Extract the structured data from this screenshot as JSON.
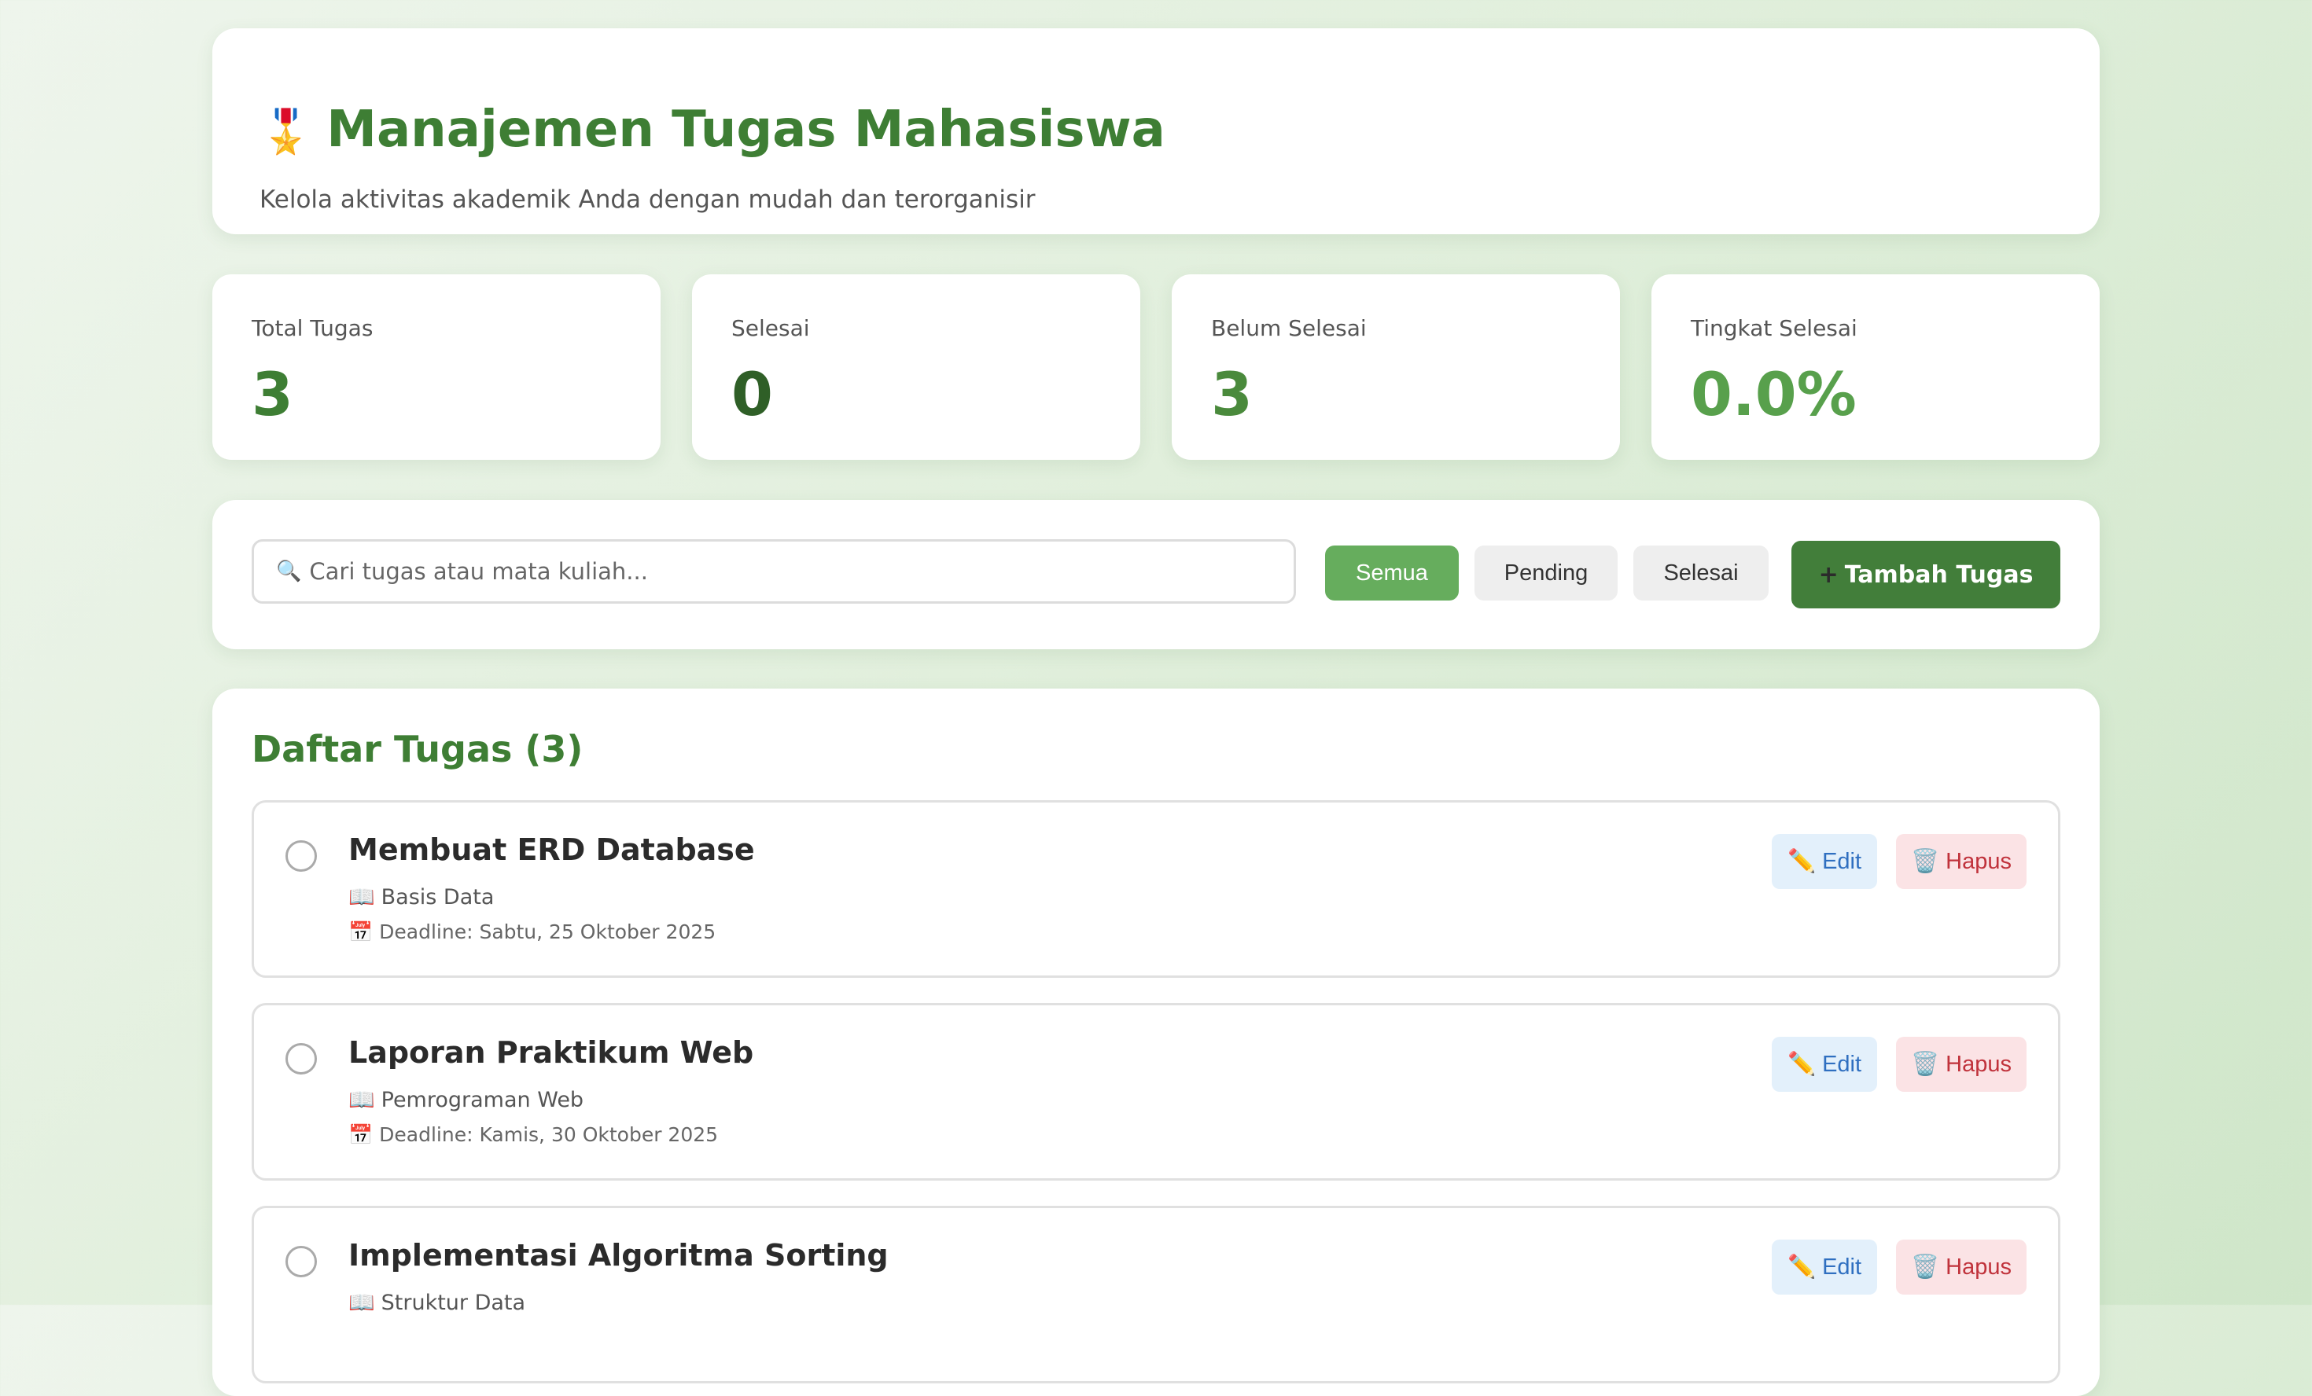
{
  "header": {
    "icon": "🎖️",
    "title": "Manajemen Tugas Mahasiswa",
    "subtitle": "Kelola aktivitas akademik Anda dengan mudah dan terorganisir"
  },
  "stats": [
    {
      "label": "Total Tugas",
      "value": "3",
      "color": "#3e7e34"
    },
    {
      "label": "Selesai",
      "value": "0",
      "color": "#2f5f27"
    },
    {
      "label": "Belum Selesai",
      "value": "3",
      "color": "#4a8a3c"
    },
    {
      "label": "Tingkat Selesai",
      "value": "0.0%",
      "color": "#58a04c"
    }
  ],
  "toolbar": {
    "search_icon": "🔍",
    "search_placeholder": "Cari tugas atau mata kuliah...",
    "filters": [
      {
        "label": "Semua",
        "active": true
      },
      {
        "label": "Pending",
        "active": false
      },
      {
        "label": "Selesai",
        "active": false
      }
    ],
    "add_plus": "+",
    "add_label": "Tambah Tugas"
  },
  "list": {
    "title": "Daftar Tugas (3)",
    "edit_icon": "✏️",
    "edit_label": "Edit",
    "delete_icon": "🗑️",
    "delete_label": "Hapus",
    "subject_icon": "📖",
    "deadline_icon": "📅",
    "tasks": [
      {
        "name": "Membuat ERD Database",
        "subject": "Basis Data",
        "deadline": "Deadline: Sabtu, 25 Oktober 2025"
      },
      {
        "name": "Laporan Praktikum Web",
        "subject": "Pemrograman Web",
        "deadline": "Deadline: Kamis, 30 Oktober 2025"
      },
      {
        "name": "Implementasi Algoritma Sorting",
        "subject": "Struktur Data",
        "deadline": ""
      }
    ]
  },
  "colors": {
    "brand": "#3e7e34",
    "active_filter": "#66ad5d",
    "add_button": "#427e3a",
    "edit_bg": "#e3f0fb",
    "delete_bg": "#fbe3e5"
  }
}
